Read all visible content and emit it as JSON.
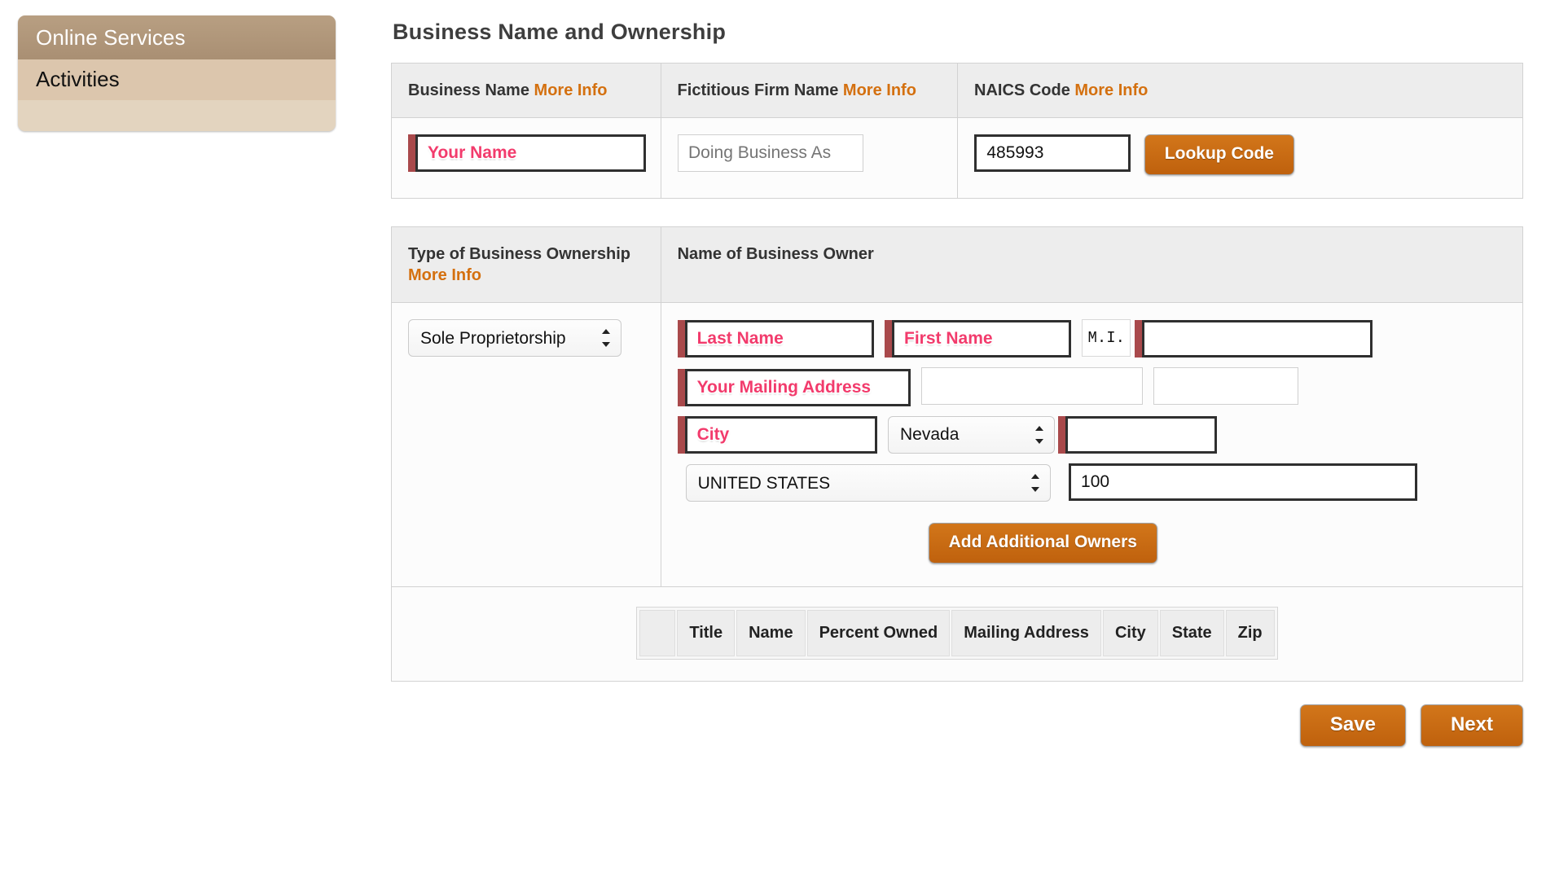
{
  "sidebar": {
    "header": "Online Services",
    "items": [
      {
        "label": "Activities"
      }
    ]
  },
  "main": {
    "page_title": "Business Name and Ownership"
  },
  "business_panel": {
    "headers": [
      {
        "label": "Business Name",
        "more_info": "More Info"
      },
      {
        "label": "Fictitious Firm Name",
        "more_info": "More Info"
      },
      {
        "label": "NAICS Code",
        "more_info": "More Info"
      }
    ],
    "business_name": {
      "value": "",
      "placeholder": "Your Name"
    },
    "fictitious_firm_name": {
      "value": "",
      "placeholder": "Doing Business As"
    },
    "naics_code": {
      "value": "485993",
      "placeholder": ""
    },
    "lookup_button": "Lookup Code"
  },
  "ownership_panel": {
    "headers": [
      {
        "label": "Type of Business Ownership",
        "more_info": "More Info"
      },
      {
        "label": "Name of Business Owner",
        "more_info": ""
      }
    ],
    "ownership_type": {
      "selected": "Sole Proprietorship",
      "options": [
        "Sole Proprietorship"
      ]
    },
    "last_name": {
      "value": "",
      "placeholder": "Last Name"
    },
    "first_name": {
      "value": "",
      "placeholder": "First Name"
    },
    "mi_label": {
      "value": "M.I.",
      "placeholder": ""
    },
    "middle_initial": {
      "value": "",
      "placeholder": ""
    },
    "address_line1": {
      "value": "",
      "placeholder": "Your Mailing Address"
    },
    "address_line2": {
      "value": "",
      "placeholder": ""
    },
    "address_line3": {
      "value": "",
      "placeholder": ""
    },
    "city": {
      "value": "",
      "placeholder": "City"
    },
    "state": {
      "selected": "Nevada",
      "options": [
        "Nevada"
      ]
    },
    "zip": {
      "value": "",
      "placeholder": ""
    },
    "country": {
      "selected": "UNITED STATES",
      "options": [
        "UNITED STATES"
      ]
    },
    "percent_owned": {
      "value": "100",
      "placeholder": ""
    },
    "add_owners_button": "Add Additional Owners"
  },
  "owners_table": {
    "columns": [
      "",
      "Title",
      "Name",
      "Percent Owned",
      "Mailing Address",
      "City",
      "State",
      "Zip"
    ]
  },
  "footer": {
    "save_label": "Save",
    "next_label": "Next"
  },
  "colors": {
    "accent_orange": "#c8690f",
    "more_info_orange": "#d4700f",
    "required_bar": "#a9494b",
    "required_text": "#f23b6c",
    "sidebar_header": "#a98f73",
    "sidebar_item": "#dcc6ad"
  }
}
